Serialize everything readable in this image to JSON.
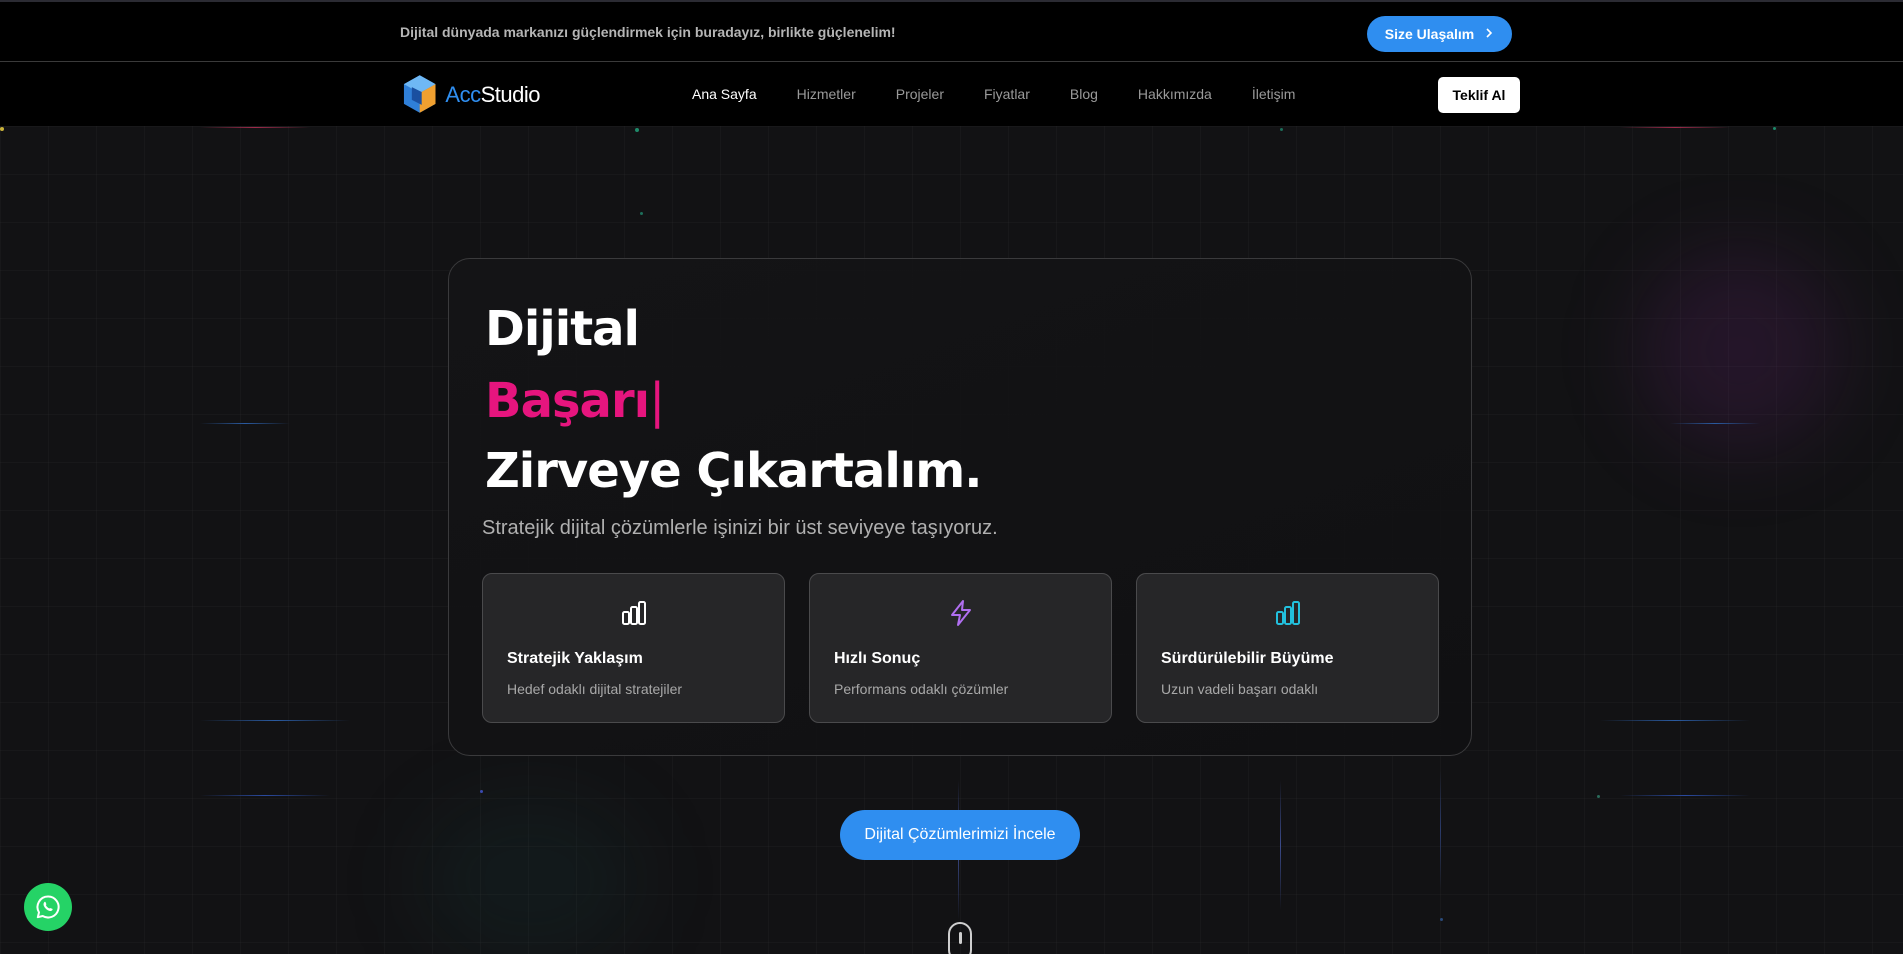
{
  "topbar": {
    "message": "Dijital dünyada markanızı güçlendirmek için buradayız, birlikte güçlenelim!",
    "contact_label": "Size Ulaşalım",
    "contact_icon": "chevron-right-icon"
  },
  "navbar": {
    "logo": {
      "prefix": "Acc",
      "suffix": "Studio"
    },
    "links": [
      {
        "label": "Ana Sayfa",
        "active": true
      },
      {
        "label": "Hizmetler",
        "active": false
      },
      {
        "label": "Projeler",
        "active": false
      },
      {
        "label": "Fiyatlar",
        "active": false
      },
      {
        "label": "Blog",
        "active": false
      },
      {
        "label": "Hakkımızda",
        "active": false
      },
      {
        "label": "İletişim",
        "active": false
      }
    ],
    "quote_label": "Teklif Al"
  },
  "hero": {
    "line1": "Dijital",
    "line2": "Başarı",
    "caret": "|",
    "line3": "Zirveye Çıkartalım.",
    "subtitle": "Stratejik dijital çözümlerle işinizi bir üst seviyeye taşıyoruz.",
    "features": [
      {
        "icon": "bar-chart-icon",
        "title": "Stratejik Yaklaşım",
        "desc": "Hedef odaklı dijital stratejiler",
        "color": "#ffffff"
      },
      {
        "icon": "lightning-icon",
        "title": "Hızlı Sonuç",
        "desc": "Performans odaklı çözümler",
        "color": "#b06ef0"
      },
      {
        "icon": "bar-chart-icon",
        "title": "Sürdürülebilir Büyüme",
        "desc": "Uzun vadeli başarı odaklı",
        "color": "#22c0dd"
      }
    ]
  },
  "cta": {
    "label": "Dijital Çözümlerimizi İncele"
  },
  "colors": {
    "accent_blue": "#2f8ef0",
    "highlight_pink": "#e6157e",
    "whatsapp_green": "#25d366"
  }
}
